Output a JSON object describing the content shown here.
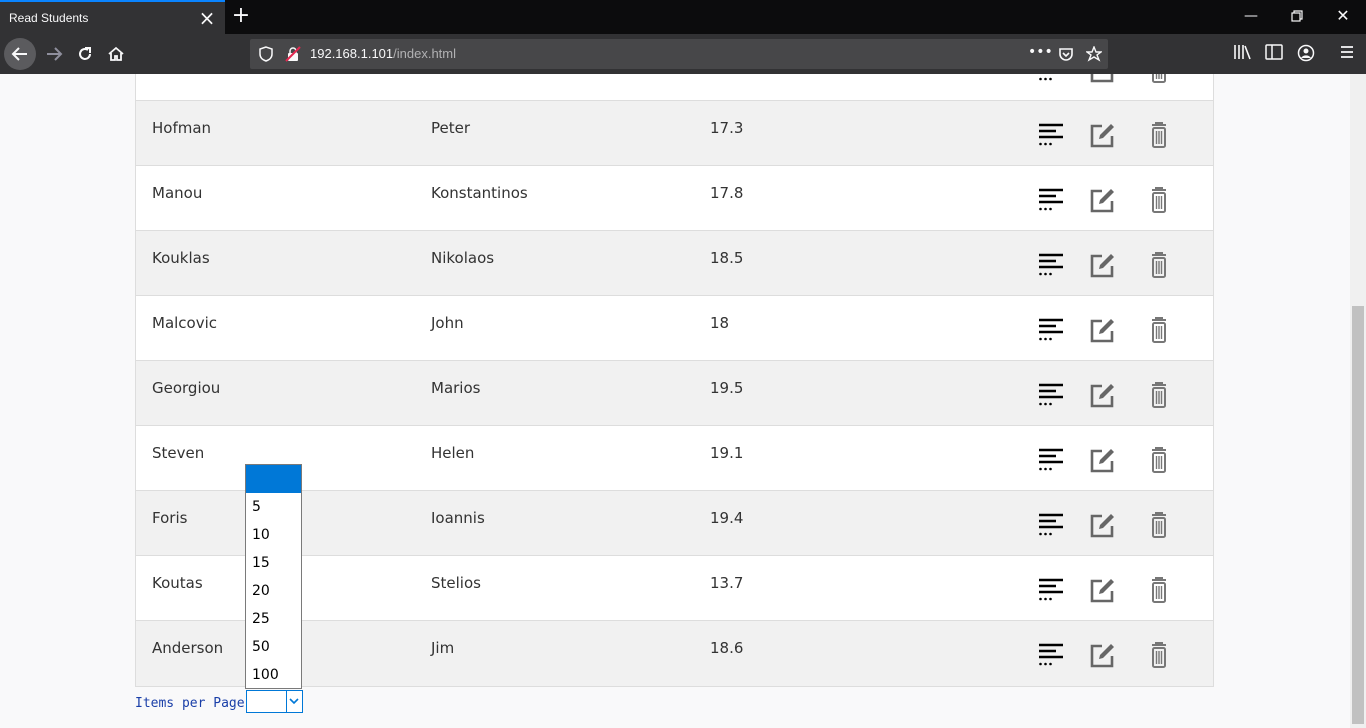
{
  "browser": {
    "tab_title": "Read Students",
    "url_host": "192.168.1.101",
    "url_path": "/index.html"
  },
  "students": [
    {
      "last": "",
      "first": "",
      "grade": ""
    },
    {
      "last": "Hofman",
      "first": "Peter",
      "grade": "17.3"
    },
    {
      "last": "Manou",
      "first": "Konstantinos",
      "grade": "17.8"
    },
    {
      "last": "Kouklas",
      "first": "Nikolaos",
      "grade": "18.5"
    },
    {
      "last": "Malcovic",
      "first": "John",
      "grade": "18"
    },
    {
      "last": "Georgiou",
      "first": "Marios",
      "grade": "19.5"
    },
    {
      "last": "Steven",
      "first": "Helen",
      "grade": "19.1"
    },
    {
      "last": "Foris",
      "first": "Ioannis",
      "grade": "19.4"
    },
    {
      "last": "Koutas",
      "first": "Stelios",
      "grade": "13.7"
    },
    {
      "last": "Anderson",
      "first": "Jim",
      "grade": "18.6"
    }
  ],
  "pagination": {
    "label": "Items per Page:",
    "options": [
      "",
      "5",
      "10",
      "15",
      "20",
      "25",
      "50",
      "100"
    ]
  },
  "icons": {
    "detail": "details-icon",
    "edit": "edit-icon",
    "delete": "trash-icon"
  },
  "colors": {
    "accent": "#0078d7",
    "label": "#1a3fa8"
  }
}
